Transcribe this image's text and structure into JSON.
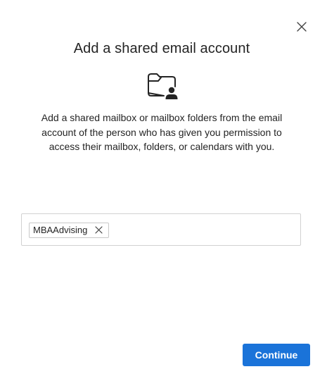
{
  "dialog": {
    "title": "Add a shared email account",
    "hero_icon": "folder-person-icon",
    "description": "Add a shared mailbox or mailbox folders from the email account of the person who has given you permission to access their mailbox, folders, or calendars with you.",
    "close_icon": "close-icon"
  },
  "recipients": {
    "chips": [
      {
        "label": "MBAAdvising",
        "remove_icon": "dismiss-icon"
      }
    ],
    "input_value": ""
  },
  "footer": {
    "continue_label": "Continue"
  },
  "colors": {
    "accent": "#1a73d9",
    "text": "#242424",
    "border": "#d1d1d1"
  }
}
